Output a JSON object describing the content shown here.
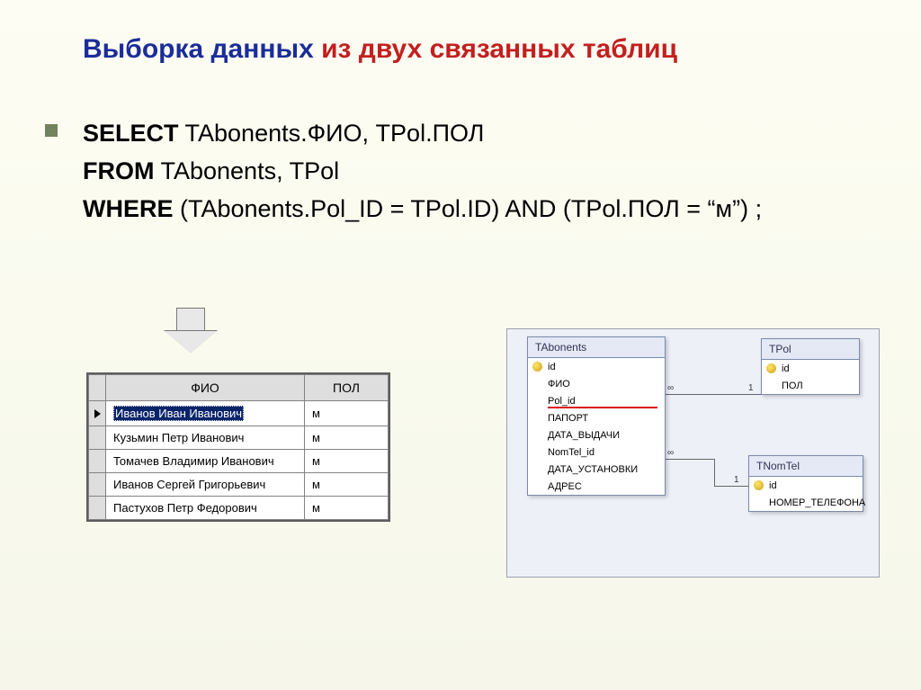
{
  "title_blue": "Выборка данных",
  "title_red": " из двух связанных таблиц",
  "sql": {
    "select_kw": "SELECT",
    "select_rest": " TAbonents.ФИО, TPol.ПОЛ",
    "from_kw": "FROM",
    "from_rest": " TAbonents, TPol",
    "where_kw": " WHERE",
    "where_rest": " (TAbonents.Pol_ID = TPol.ID) AND (TPol.ПОЛ = “м”) ;"
  },
  "result": {
    "headers": {
      "fio": "ФИО",
      "pol": "ПОЛ"
    },
    "rows": [
      {
        "fio": "Иванов Иван Иванович",
        "pol": "м",
        "selected": true,
        "current": true
      },
      {
        "fio": "Кузьмин Петр Иванович",
        "pol": "м"
      },
      {
        "fio": "Томачев Владимир Иванович",
        "pol": "м"
      },
      {
        "fio": "Иванов Сергей Григорьевич",
        "pol": "м"
      },
      {
        "fio": "Пастухов Петр Федорович",
        "pol": "м"
      }
    ]
  },
  "schema": {
    "tabonents": {
      "title": "TAbonents",
      "fields": [
        "id",
        "ФИО",
        "Pol_id",
        "ПАПОРТ",
        "ДАТА_ВЫДАЧИ",
        "NomTel_id",
        "ДАТА_УСТАНОВКИ",
        "АДРЕС"
      ],
      "key_index": 0,
      "underline_index": 2
    },
    "tpol": {
      "title": "TPol",
      "fields": [
        "id",
        "ПОЛ"
      ],
      "key_index": 0
    },
    "tnomtel": {
      "title": "TNomTel",
      "fields": [
        "id",
        "НОМЕР_ТЕЛЕФОНА"
      ],
      "key_index": 0
    },
    "rel_labels": {
      "inf": "∞",
      "one": "1"
    }
  }
}
